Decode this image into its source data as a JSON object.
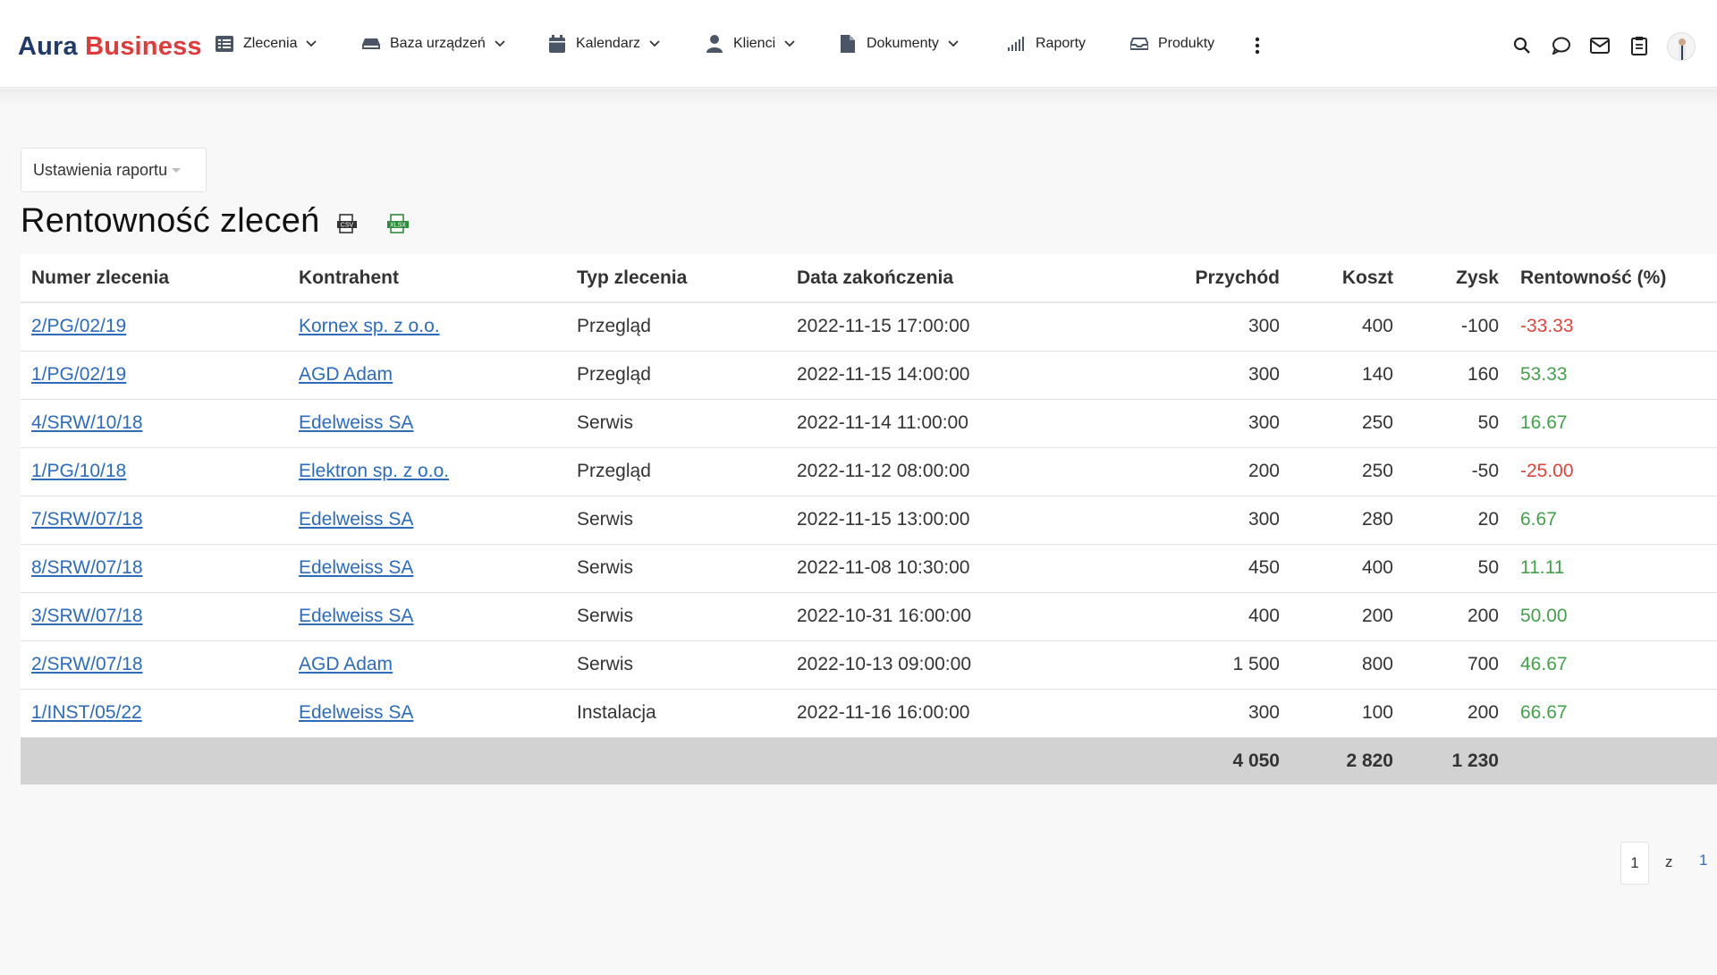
{
  "app": {
    "logo_part1": "Aura",
    "logo_part2": "Business"
  },
  "nav": [
    {
      "label": "Zlecenia",
      "icon": "list-icon",
      "dropdown": true
    },
    {
      "label": "Baza urządzeń",
      "icon": "device-icon",
      "dropdown": true
    },
    {
      "label": "Kalendarz",
      "icon": "calendar-icon",
      "dropdown": true
    },
    {
      "label": "Klienci",
      "icon": "user-icon",
      "dropdown": true
    },
    {
      "label": "Dokumenty",
      "icon": "document-icon",
      "dropdown": true
    },
    {
      "label": "Raporty",
      "icon": "signal-icon",
      "dropdown": false
    },
    {
      "label": "Produkty",
      "icon": "inbox-icon",
      "dropdown": false
    }
  ],
  "header_icons": [
    "more-vertical-icon",
    "search-icon",
    "chat-icon",
    "mail-icon",
    "clipboard-icon",
    "avatar"
  ],
  "report": {
    "settings_label": "Ustawienia raportu",
    "title": "Rentowność zleceń",
    "export_csv_label": "CSV",
    "export_xlsx_label": "XLSX"
  },
  "table": {
    "columns": [
      "Numer zlecenia",
      "Kontrahent",
      "Typ zlecenia",
      "Data zakończenia",
      "Przychód",
      "Koszt",
      "Zysk",
      "Rentowność (%)"
    ],
    "rows": [
      {
        "number": "2/PG/02/19",
        "client": "Kornex sp. z o.o.",
        "type": "Przegląd",
        "date": "2022-11-15 17:00:00",
        "revenue": "300",
        "cost": "400",
        "profit": "-100",
        "margin": "-33.33",
        "status": "negative"
      },
      {
        "number": "1/PG/02/19",
        "client": "AGD Adam",
        "type": "Przegląd",
        "date": "2022-11-15 14:00:00",
        "revenue": "300",
        "cost": "140",
        "profit": "160",
        "margin": "53.33",
        "status": "positive"
      },
      {
        "number": "4/SRW/10/18",
        "client": "Edelweiss SA",
        "type": "Serwis",
        "date": "2022-11-14 11:00:00",
        "revenue": "300",
        "cost": "250",
        "profit": "50",
        "margin": "16.67",
        "status": "positive"
      },
      {
        "number": "1/PG/10/18",
        "client": "Elektron sp. z o.o.",
        "type": "Przegląd",
        "date": "2022-11-12 08:00:00",
        "revenue": "200",
        "cost": "250",
        "profit": "-50",
        "margin": "-25.00",
        "status": "negative"
      },
      {
        "number": "7/SRW/07/18",
        "client": "Edelweiss SA",
        "type": "Serwis",
        "date": "2022-11-15 13:00:00",
        "revenue": "300",
        "cost": "280",
        "profit": "20",
        "margin": "6.67",
        "status": "positive"
      },
      {
        "number": "8/SRW/07/18",
        "client": "Edelweiss SA",
        "type": "Serwis",
        "date": "2022-11-08 10:30:00",
        "revenue": "450",
        "cost": "400",
        "profit": "50",
        "margin": "11.11",
        "status": "positive"
      },
      {
        "number": "3/SRW/07/18",
        "client": "Edelweiss SA",
        "type": "Serwis",
        "date": "2022-10-31 16:00:00",
        "revenue": "400",
        "cost": "200",
        "profit": "200",
        "margin": "50.00",
        "status": "positive"
      },
      {
        "number": "2/SRW/07/18",
        "client": "AGD Adam",
        "type": "Serwis",
        "date": "2022-10-13 09:00:00",
        "revenue": "1 500",
        "cost": "800",
        "profit": "700",
        "margin": "46.67",
        "status": "positive"
      },
      {
        "number": "1/INST/05/22",
        "client": "Edelweiss SA",
        "type": "Instalacja",
        "date": "2022-11-16 16:00:00",
        "revenue": "300",
        "cost": "100",
        "profit": "200",
        "margin": "66.67",
        "status": "positive"
      }
    ],
    "totals": {
      "revenue": "4 050",
      "cost": "2 820",
      "profit": "1 230"
    }
  },
  "pagination": {
    "current": "1",
    "of_label": "z",
    "total": "1"
  },
  "colors": {
    "brand_dark": "#1f3a6b",
    "brand_red": "#e03a3a",
    "link": "#2d6bbd",
    "negative": "#e0433c",
    "positive": "#44a04a",
    "totals_bg": "#d2d2d2"
  }
}
